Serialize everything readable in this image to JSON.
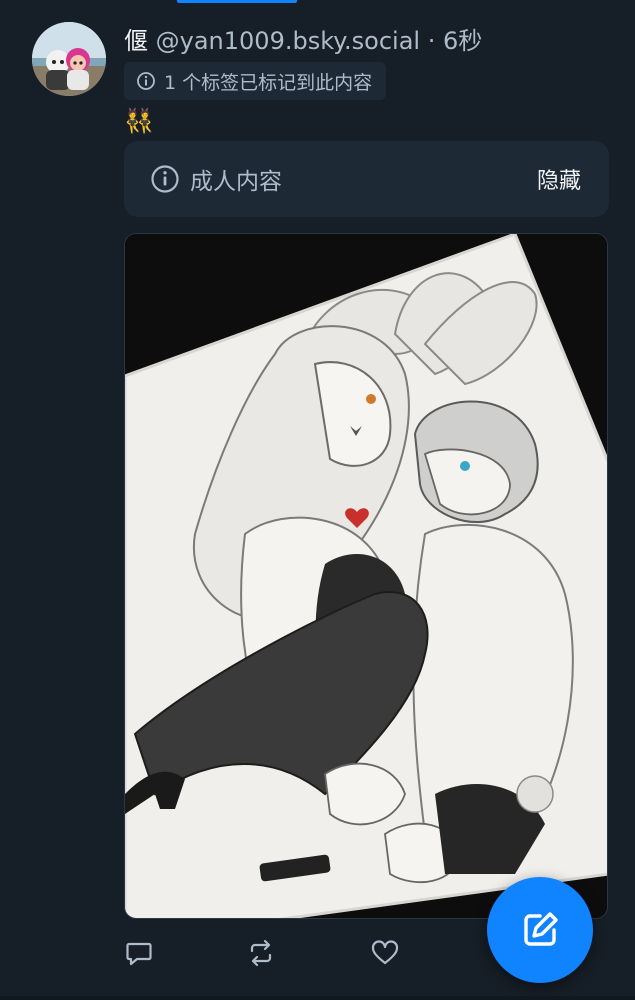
{
  "post": {
    "display_name": "偃",
    "handle": "@yan1009.bsky.social",
    "separator": "·",
    "timestamp": "6秒",
    "label_notice": "1 个标签已标记到此内容",
    "text": "👯",
    "content_warning": {
      "label": "成人内容",
      "action": "隐藏"
    }
  },
  "actions": [
    "reply-icon",
    "repost-icon",
    "like-icon"
  ],
  "fab": {
    "icon": "compose-icon",
    "color": "#1083fe"
  },
  "colors": {
    "background": "#161e27",
    "card": "#1e2936",
    "accent": "#1083fe",
    "muted_text": "#aebbc9"
  }
}
